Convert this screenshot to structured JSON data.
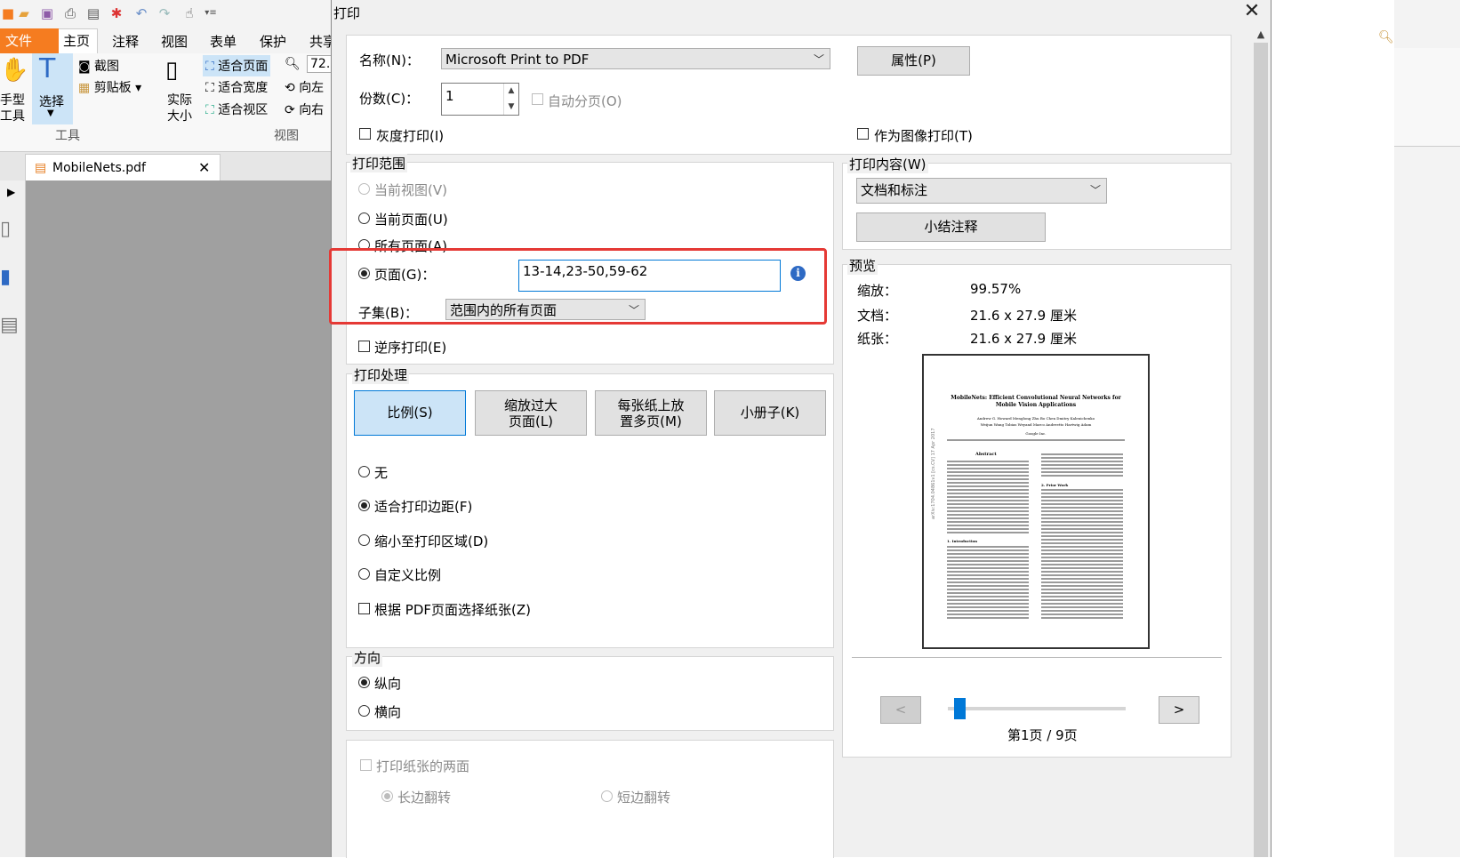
{
  "app": {
    "file_tab": "文件",
    "tabs": [
      "主页",
      "注释",
      "视图",
      "表单",
      "保护",
      "共享"
    ],
    "ribbon": {
      "hand_tool": "手型\n工具",
      "select": "选择",
      "screenshot": "截图",
      "clipboard": "剪贴板",
      "tools_group": "工具",
      "actual_size": "实际\n大小",
      "fit_page": "适合页面",
      "fit_width": "适合宽度",
      "fit_visible": "适合视区",
      "zoom_value": "72.",
      "rotate_left": "向左",
      "rotate_right": "向右",
      "view_group": "视图"
    },
    "doc_tab": "MobileNets.pdf"
  },
  "dialog": {
    "title": "打印",
    "printer": {
      "name_label": "名称(N)：",
      "name_value": "Microsoft Print to PDF",
      "properties_button": "属性(P)",
      "copies_label": "份数(C)：",
      "copies_value": "1",
      "collate_label": "自动分页(O)",
      "grayscale_label": "灰度打印(I)",
      "print_as_image_label": "作为图像打印(T)"
    },
    "range": {
      "group_label": "打印范围",
      "current_view": "当前视图(V)",
      "current_page": "当前页面(U)",
      "all_pages": "所有页面(A)",
      "pages_label": "页面(G)：",
      "pages_value": "13-14,23-50,59-62",
      "subset_label": "子集(B)：",
      "subset_value": "范围内的所有页面",
      "reverse_label": "逆序打印(E)"
    },
    "handling": {
      "group_label": "打印处理",
      "buttons": [
        "比例(S)",
        "缩放过大\n页面(L)",
        "每张纸上放\n置多页(M)",
        "小册子(K)"
      ],
      "none": "无",
      "fit_margins": "适合打印边距(F)",
      "shrink": "缩小至打印区域(D)",
      "custom": "自定义比例",
      "choose_paper": "根据 PDF页面选择纸张(Z)"
    },
    "orientation": {
      "group_label": "方向",
      "portrait": "纵向",
      "landscape": "横向"
    },
    "duplex": {
      "both_sides": "打印纸张的两面",
      "long_edge": "长边翻转",
      "short_edge": "短边翻转"
    },
    "content": {
      "group_label": "打印内容(W)",
      "value": "文档和标注",
      "summary_button": "小结注释"
    },
    "preview": {
      "group_label": "预览",
      "zoom_label": "缩放：",
      "zoom_value": "99.57%",
      "doc_label": "文档：",
      "doc_value": "21.6 x 27.9 厘米",
      "paper_label": "纸张：",
      "paper_value": "21.6 x 27.9 厘米",
      "page_title": "MobileNets: Efficient Convolutional Neural Networks for Mobile Vision Applications",
      "page_authors": "Andrew G. Howard    Menglong Zhu    Bo Chen    Dmitry Kalenichenko",
      "page_authors2": "Weijun Wang    Tobias Weyand    Marco Andreetto    Hartwig Adam",
      "page_affil": "Google Inc.",
      "page_abstract": "Abstract",
      "page_intro": "1. Introduction",
      "page_prior": "2. Prior Work",
      "page_side": "arXiv:1704.04861v1 [cs.CV] 17 Apr 2017",
      "prev_button": "<",
      "next_button": ">",
      "page_counter": "第1页 / 9页"
    }
  },
  "colors": {
    "accent": "#0078d7",
    "file_tab": "#f57c20",
    "highlight_box": "#e53935"
  }
}
